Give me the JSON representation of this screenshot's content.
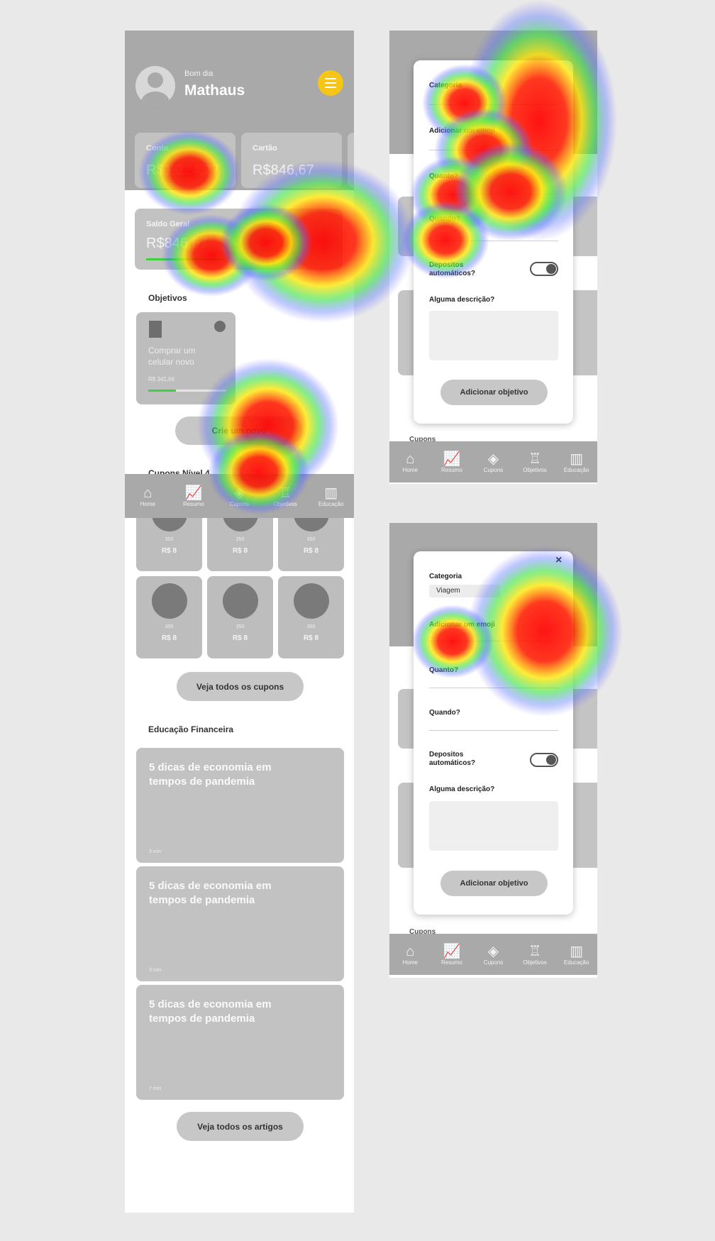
{
  "screen1": {
    "greeting": "Bom dia",
    "user_name": "Mathaus",
    "cards": [
      {
        "label": "Conta",
        "value": "R$1.224,27"
      },
      {
        "label": "Cartão",
        "value": "R$846,67"
      }
    ],
    "saldo": {
      "label": "Saldo Geral",
      "value": "R$846,67"
    },
    "objetivos_title": "Objetivos",
    "goal": {
      "text": "Comprar um celular novo",
      "amount": "R$ 341,66",
      "progress": 0.35
    },
    "create_button": "Crie um novo",
    "cupons_title": "Cupons Nível 4",
    "coupons": [
      {
        "pts": "350",
        "price": "R$ 8"
      },
      {
        "pts": "350",
        "price": "R$ 8"
      },
      {
        "pts": "350",
        "price": "R$ 8"
      },
      {
        "pts": "350",
        "price": "R$ 8"
      },
      {
        "pts": "350",
        "price": "R$ 8"
      },
      {
        "pts": "350",
        "price": "R$ 8"
      }
    ],
    "coupons_button": "Veja todos os cupons",
    "edu_title": "Educação Financeira",
    "articles": [
      {
        "title": "5 dicas de economia em tempos de pandemia",
        "time": "3 min"
      },
      {
        "title": "5 dicas de economia em tempos de pandemia",
        "time": "3 min"
      },
      {
        "title": "5 dicas de economia em tempos de pandemia",
        "time": "7 min"
      }
    ],
    "articles_button": "Veja todos os artigos"
  },
  "nav": [
    {
      "label": "Home",
      "icon": "home-icon"
    },
    {
      "label": "Resumo",
      "icon": "chart-icon"
    },
    {
      "label": "Cupons",
      "icon": "ticket-icon"
    },
    {
      "label": "Objetivos",
      "icon": "trophy-icon"
    },
    {
      "label": "Educação",
      "icon": "book-icon"
    }
  ],
  "modal1": {
    "categoria": "Categoria",
    "adicionar": "Adicionar um emoji",
    "quanto": "Quanto?",
    "quando": "Quando?",
    "depositos": "Depositos automáticos?",
    "descricao": "Alguma descrição?",
    "button": "Adicionar objetivo",
    "cupons_peek": "Cupons"
  },
  "modal2": {
    "categoria": "Categoria",
    "categoria_value": "Viagem",
    "adicionar": "Adicionar um emoji",
    "quanto": "Quanto?",
    "quando": "Quando?",
    "depositos": "Depositos automáticos?",
    "descricao": "Alguma descrição?",
    "button": "Adicionar objetivo",
    "close": "×",
    "cupons_peek": "Cupons"
  },
  "colors": {
    "accent": "#f5c518",
    "header": "#a9a9a9",
    "card": "#c2c2c2",
    "progress": "#3fcf3f"
  }
}
